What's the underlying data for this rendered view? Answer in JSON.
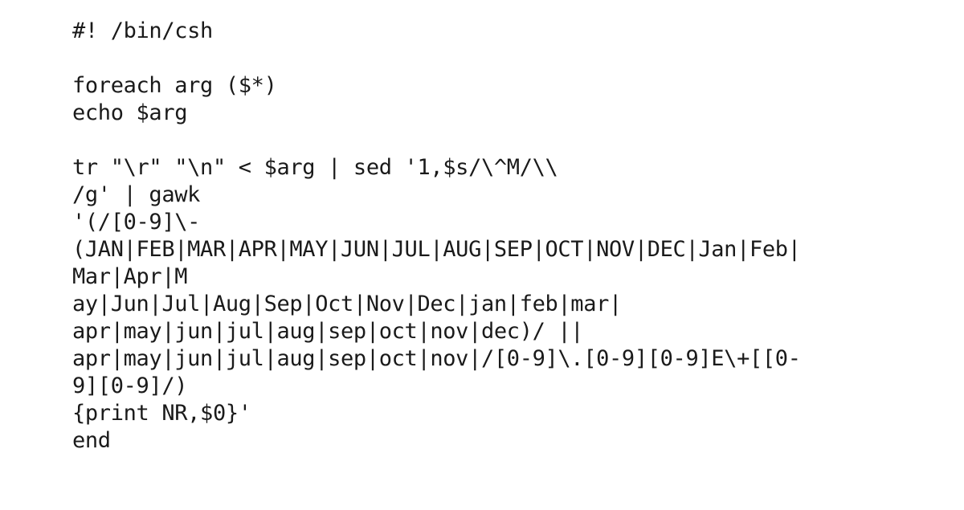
{
  "document": {
    "type": "shell-script-listing",
    "interpreter": "#! /bin/csh",
    "background_color": "#ffffff",
    "text_color": "#1a1a1a",
    "lines": [
      {
        "id": "line-1",
        "text": "#! /bin/csh"
      },
      {
        "id": "line-2",
        "text": ""
      },
      {
        "id": "line-3",
        "text": "foreach arg ($*)"
      },
      {
        "id": "line-4",
        "text": "echo $arg"
      },
      {
        "id": "line-5",
        "text": ""
      },
      {
        "id": "line-6",
        "text": "tr \"\\r\" \"\\n\" < $arg | sed '1,$s/\\^M/\\\\"
      },
      {
        "id": "line-7",
        "text": "/g' | gawk"
      },
      {
        "id": "line-8",
        "text": "'(/[0-9]\\-"
      },
      {
        "id": "line-9",
        "text": "(JAN|FEB|MAR|APR|MAY|JUN|JUL|AUG|SEP|OCT|NOV|DEC|Jan|Feb|"
      },
      {
        "id": "line-10",
        "text": "Mar|Apr|M"
      },
      {
        "id": "line-11",
        "text": "ay|Jun|Jul|Aug|Sep|Oct|Nov|Dec|jan|feb|mar|"
      },
      {
        "id": "line-12",
        "text": "apr|may|jun|jul|aug|sep|oct|nov|dec)/ ||"
      },
      {
        "id": "line-13",
        "text": "apr|may|jun|jul|aug|sep|oct|nov|/[0-9]\\.[0-9][0-9]E\\+[[0-"
      },
      {
        "id": "line-14",
        "text": "9][0-9]/)"
      },
      {
        "id": "line-15",
        "text": "{print NR,$0}'"
      },
      {
        "id": "line-16",
        "text": "end"
      }
    ]
  }
}
